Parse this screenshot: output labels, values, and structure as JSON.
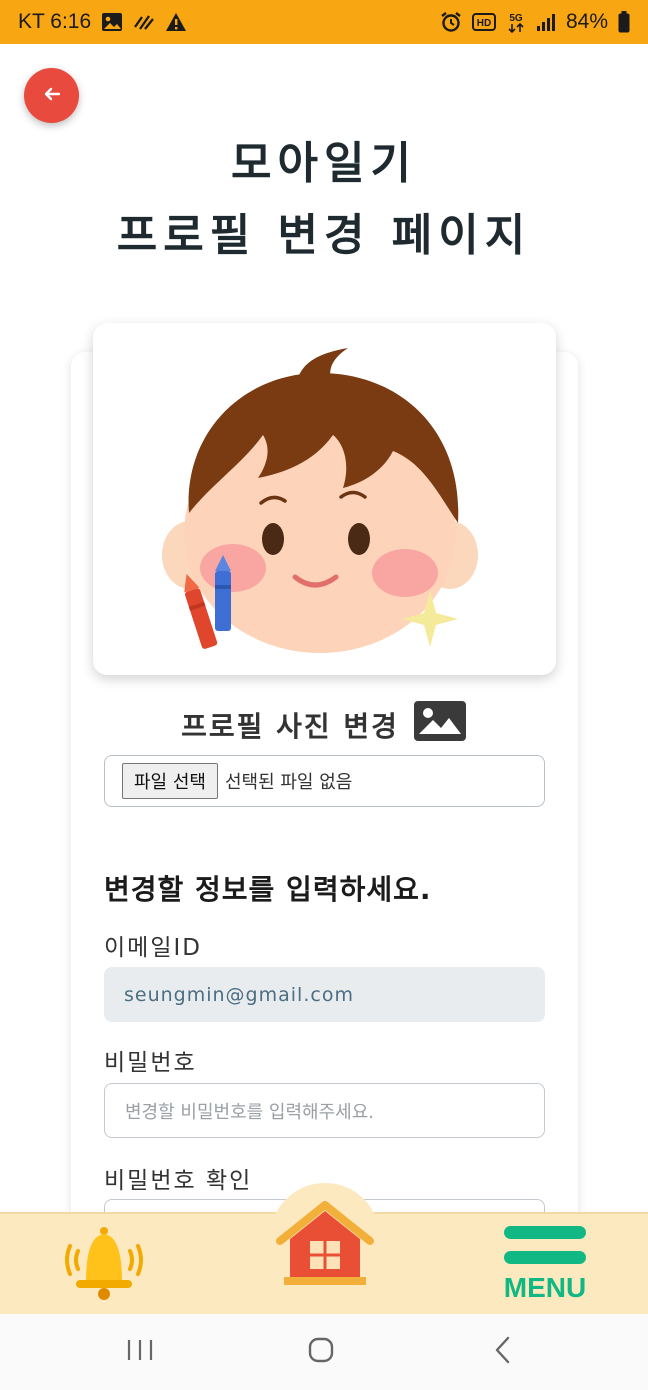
{
  "status_bar": {
    "carrier_time": "KT 6:16",
    "battery": "84%",
    "bg_color": "#f9a613"
  },
  "header": {
    "back_icon": "arrow-left-icon",
    "title_line1": "모아일기",
    "title_line2": "프로필 변경 페이지"
  },
  "profile": {
    "photo_change_label": "프로필 사진 변경",
    "photo_icon": "image-icon",
    "file_button": "파일 선택",
    "file_status": "선택된 파일 없음"
  },
  "form": {
    "section_title": "변경할 정보를 입력하세요.",
    "email_label": "이메일ID",
    "email_value": "seungmin@gmail.com",
    "password_label": "비밀번호",
    "password_placeholder": "변경할 비밀번호를 입력해주세요.",
    "password_confirm_label": "비밀번호 확인"
  },
  "bottom_nav": {
    "bell_icon": "bell-icon",
    "home_icon": "house-icon",
    "menu_label": "MENU",
    "menu_color": "#12b883",
    "bg_color": "#fde9bf"
  },
  "system_nav": {
    "recents_icon": "recents-icon",
    "home_icon": "home-circle-icon",
    "back_icon": "chevron-left-icon"
  }
}
